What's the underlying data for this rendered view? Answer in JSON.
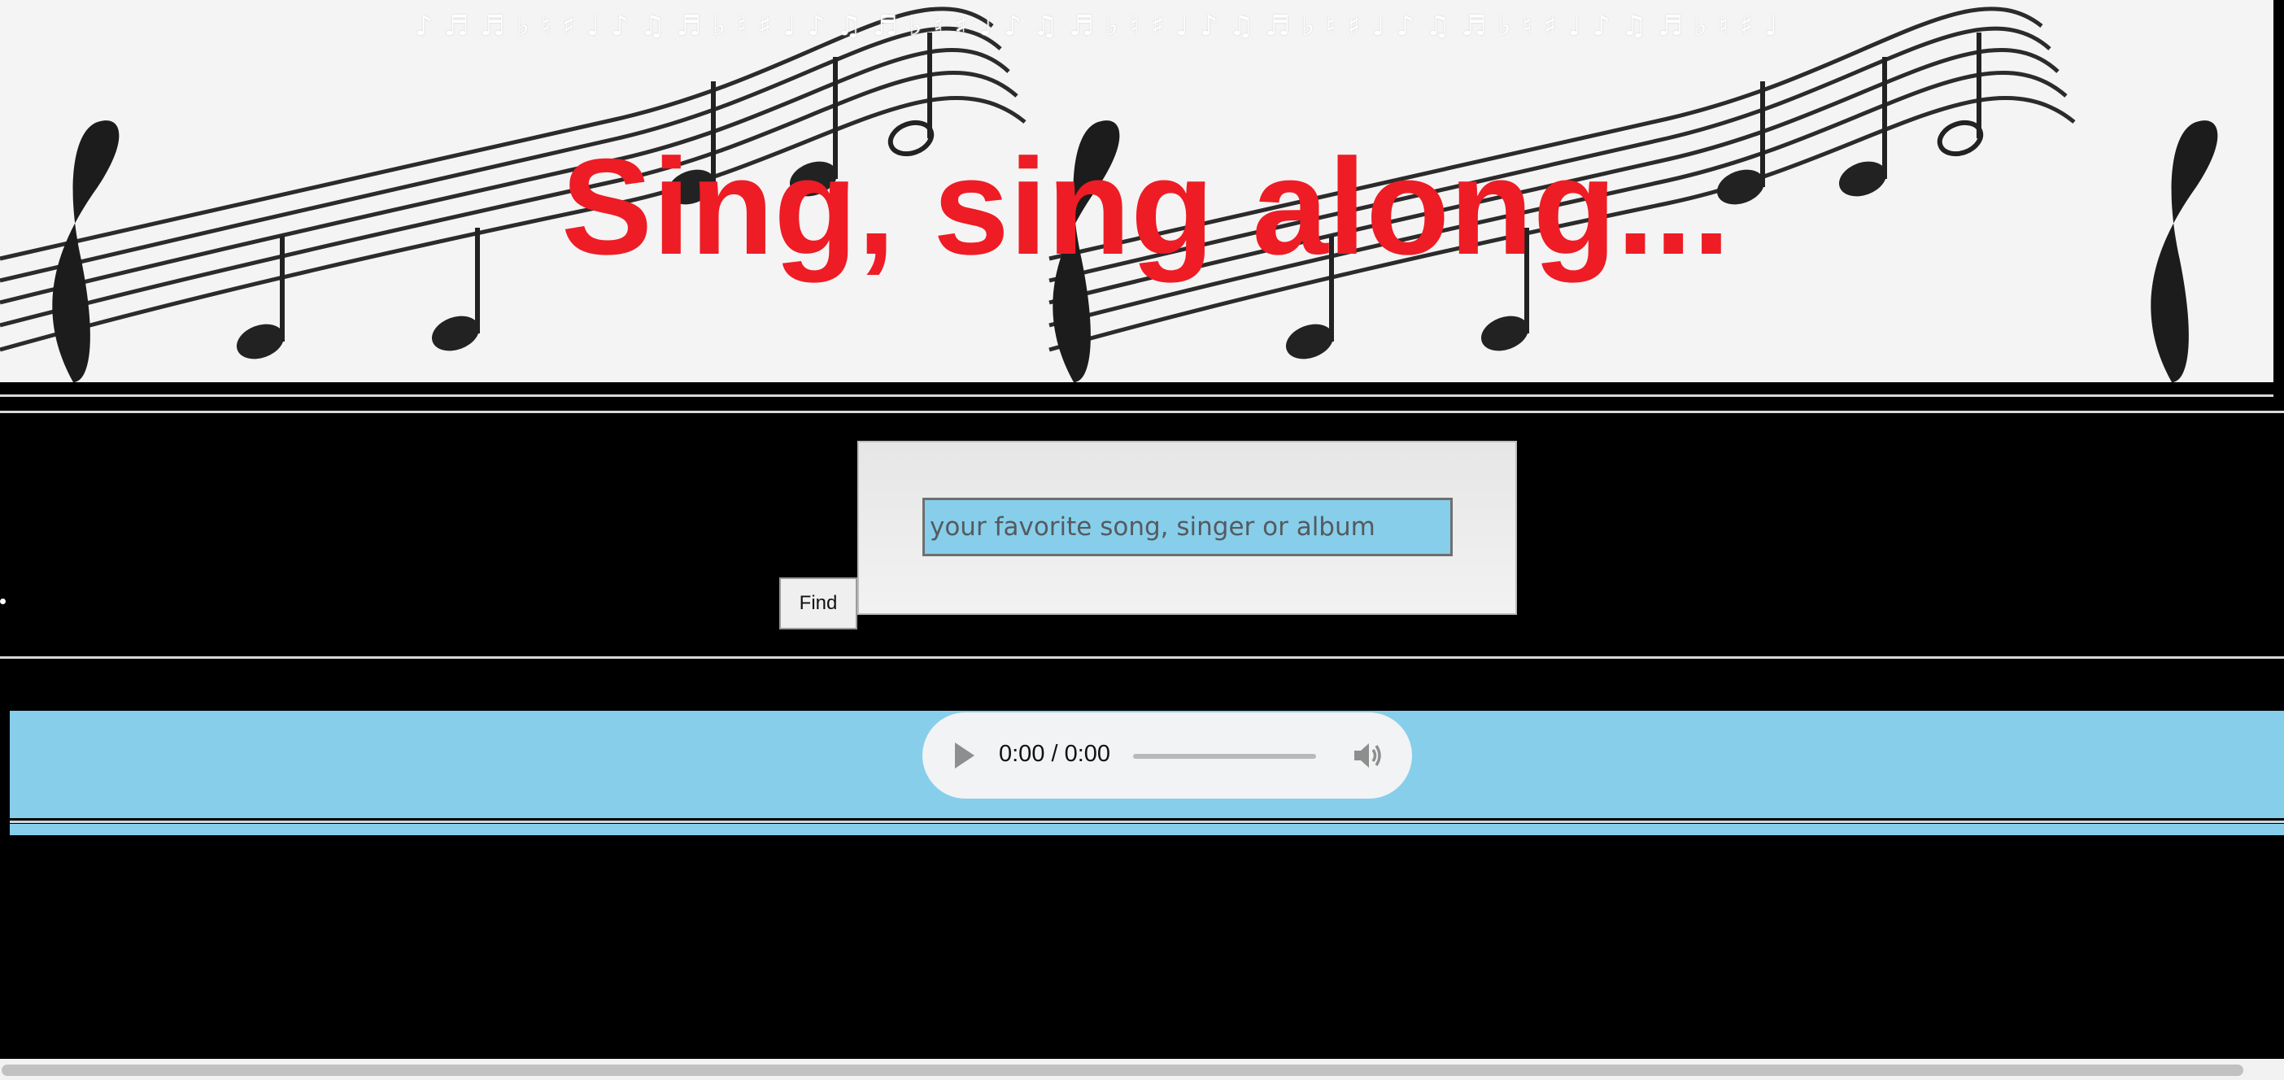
{
  "header": {
    "title": "Sing, sing along...",
    "note_strip": "♪♬♬♭♮♯♩♪♫♬♭♮♯♩♪♫♬♭♮♯♩♪♫♬♭♮♯♩♪♫♬♭♮♯♩♪♫♬♭♮♯♩♪♫♬♭♮♯♩",
    "title_color": "#ee1c25"
  },
  "search": {
    "find_label": "Find",
    "placeholder": "your favorite song, singer or album",
    "value": "",
    "input_color": "#87ceeb"
  },
  "player": {
    "time": "0:00 / 0:00",
    "band_color": "#87ceeb"
  }
}
